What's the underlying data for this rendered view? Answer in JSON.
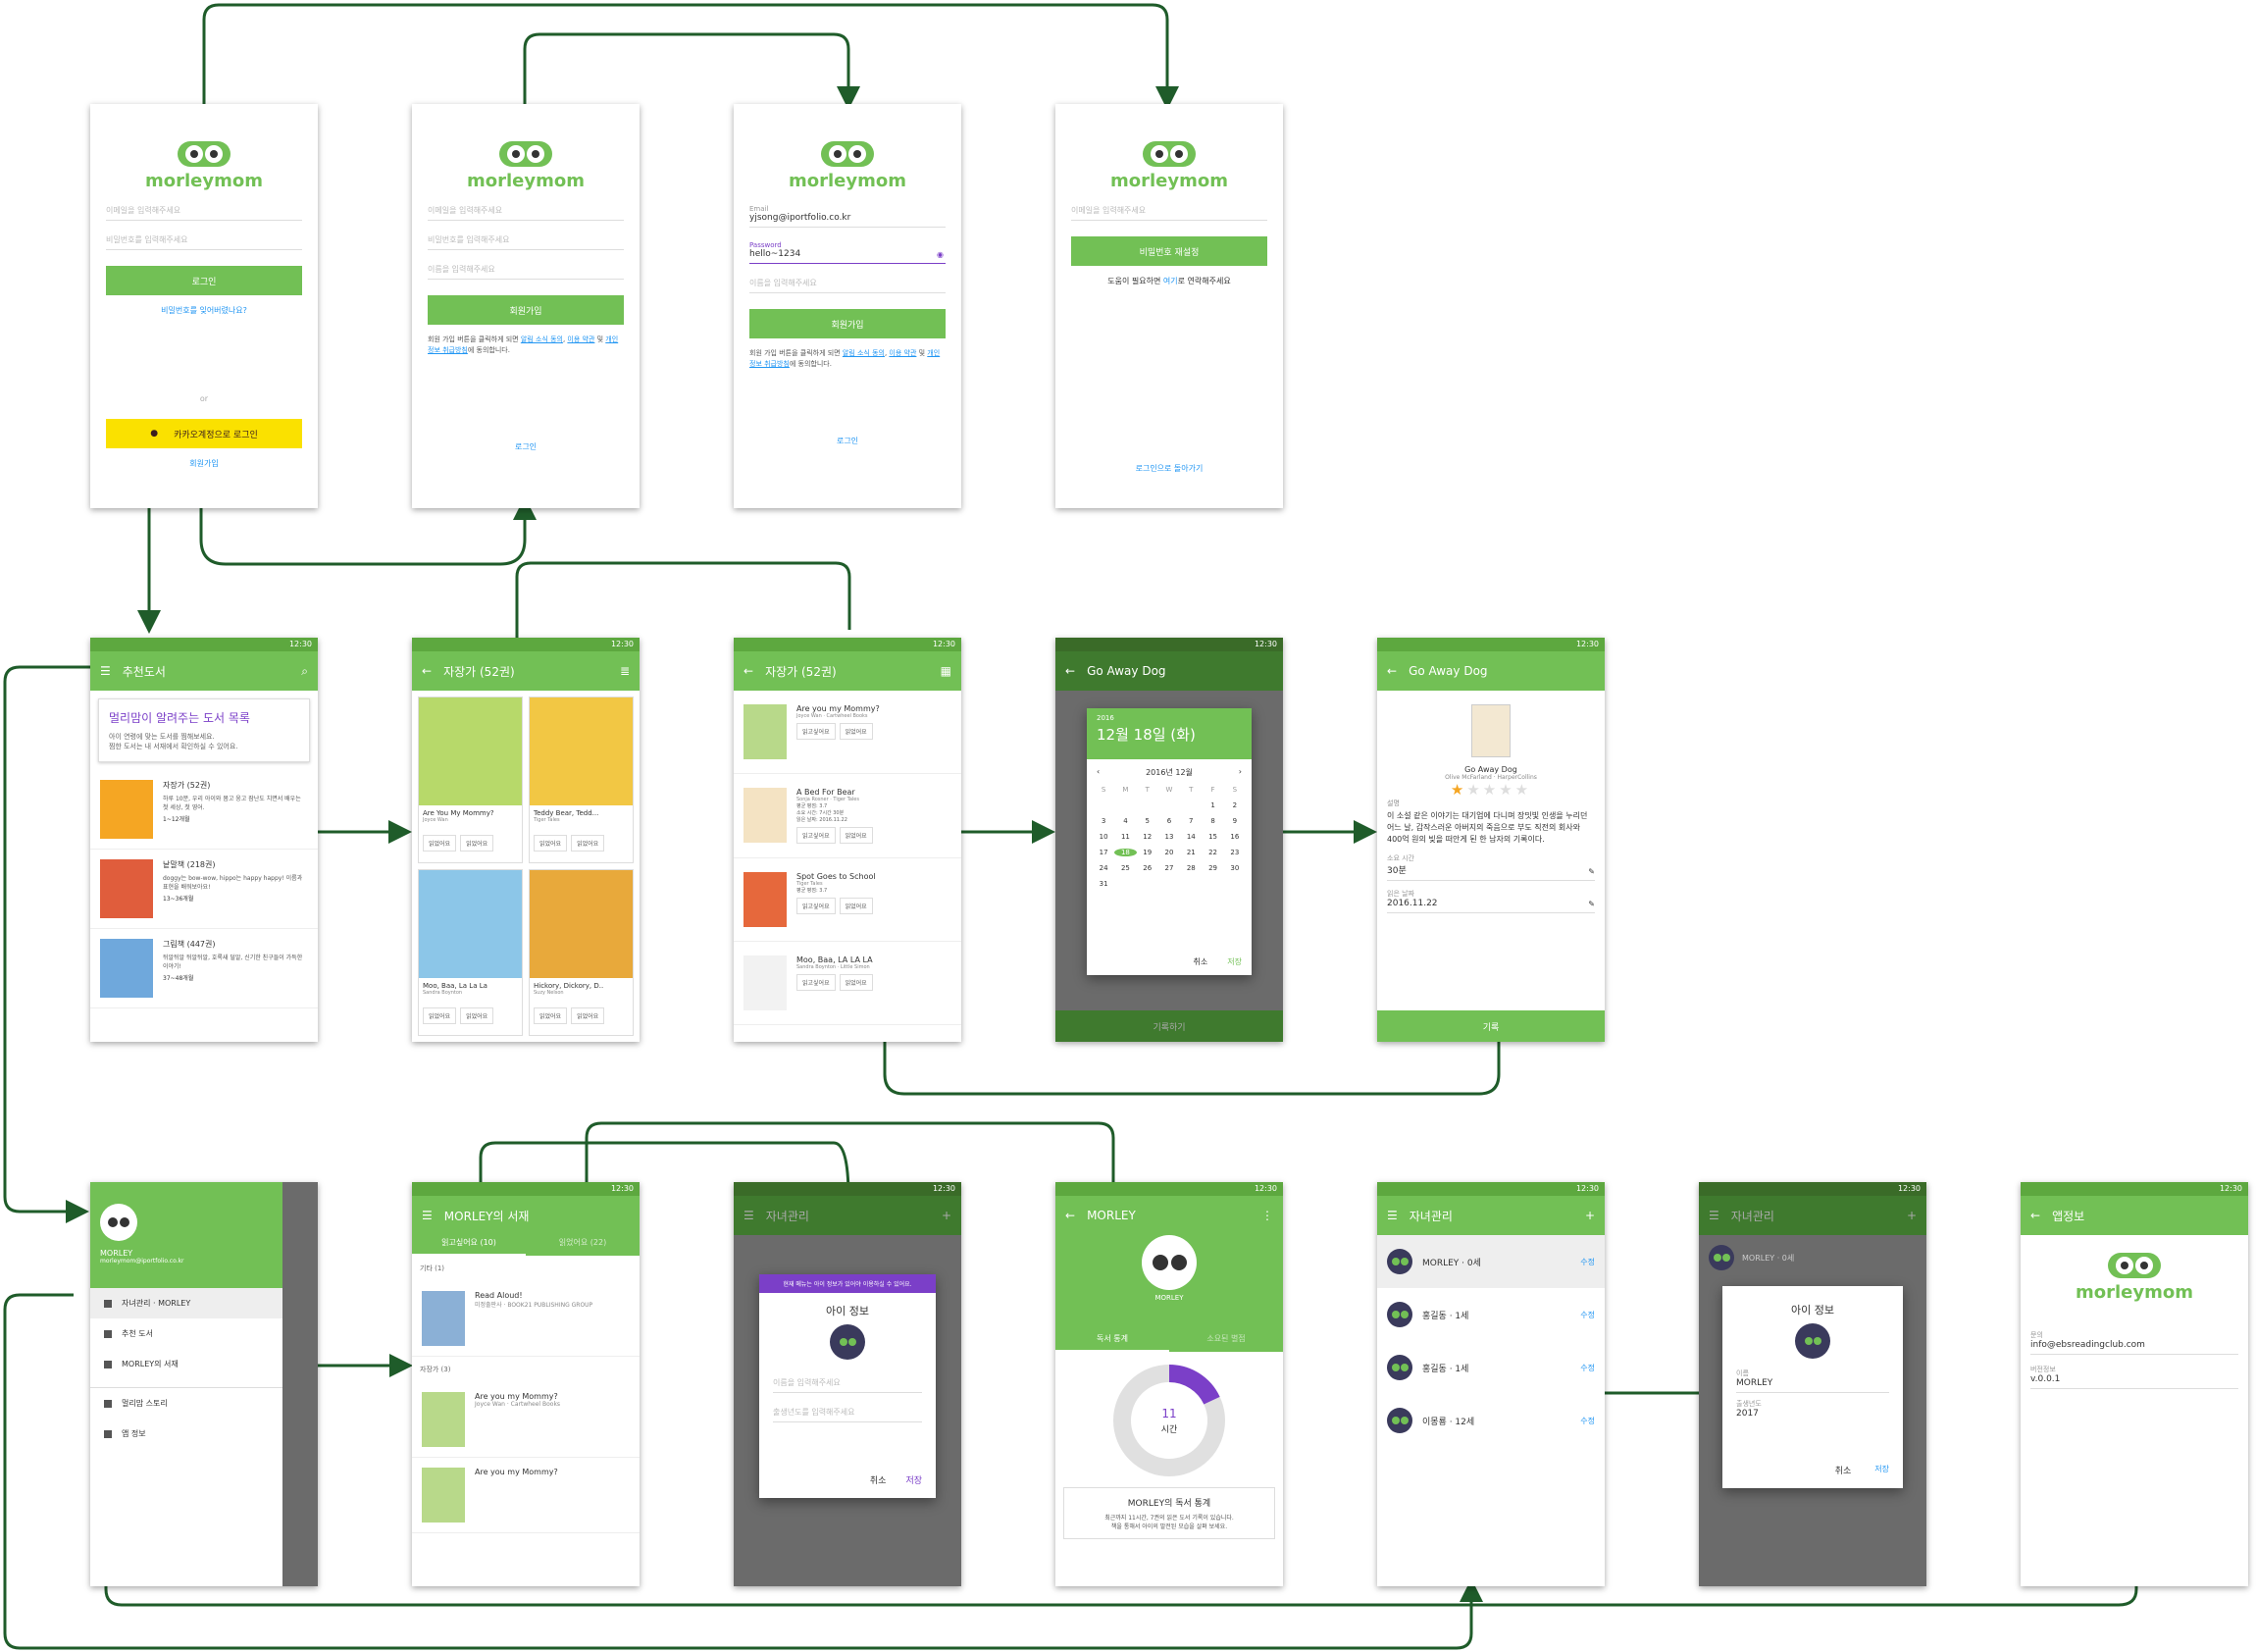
{
  "brand": "morleymom",
  "time": "12:30",
  "login": {
    "email_ph": "이메일을 입력해주세요",
    "pw_ph": "비밀번호를 입력해주세요",
    "login_btn": "로그인",
    "forgot": "비밀번호를 잊어버렸나요?",
    "or": "or",
    "kakao": "카카오계정으로 로그인",
    "signup_link": "회원가입"
  },
  "signup": {
    "email_ph": "이메일을 입력해주세요",
    "pw_ph": "비밀번호를 입력해주세요",
    "name_ph": "이름을 입력해주세요",
    "btn": "회원가입",
    "terms_pre": "회원 가입 버튼을 클릭하게 되면 ",
    "terms_a": "알림 소식 동의",
    "terms_b": "이용 약관",
    "terms_c": "개인정보 취급방침",
    "terms_post": "에 동의합니다.",
    "login_link": "로그인"
  },
  "signup_filled": {
    "email_label": "Email",
    "email": "yjsong@iportfolio.co.kr",
    "pw_label": "Password",
    "pw": "hello~1234"
  },
  "reset": {
    "btn": "비밀번호 재설정",
    "help_pre": "도움이 필요하면 ",
    "help_link": "여기",
    "help_post": "로 연락해주세요",
    "back": "로그인으로 돌아가기"
  },
  "home": {
    "title": "추천도서",
    "banner_title": "멀리맘이 알려주는 도서 목록",
    "banner_sub1": "아이 연령에 맞는 도서를 찜해보세요.",
    "banner_sub2": "찜한 도서는 내 서재에서 확인하실 수 있어요.",
    "cats": [
      {
        "name": "자장가 (52권)",
        "desc": "하루 10분, 우리 아이와 몸고 웅고 잠난도 치면서 배우는 첫 세상, 첫 영어.",
        "age": "1~12개월"
      },
      {
        "name": "낱말책 (218권)",
        "desc": "doggy는 bow-wow, hippo는 happy happy! 이름과 표현을 배워보아요!",
        "age": "13~36개월"
      },
      {
        "name": "그림책 (447권)",
        "desc": "뒤알뒤알 뒤알뒤알, 호록새 덜알, 신기한 친구들이 가득한 이야기!",
        "age": "37~48개월"
      }
    ]
  },
  "shelf": {
    "title": "자장가 (52권)",
    "books": [
      {
        "t": "Are You My Mommy?",
        "a": "Joyce Wan"
      },
      {
        "t": "Teddy Bear, Tedd...",
        "a": "Tiger Tales"
      },
      {
        "t": "Moo, Baa, La La La",
        "a": "Sandra Boynton"
      },
      {
        "t": "Hickory, Dickory, D..",
        "a": "Suzy Nelson"
      }
    ],
    "btn_a": "읽었어요",
    "btn_b": "읽었어요"
  },
  "shelf_list": {
    "title": "자장가 (52권)",
    "books": [
      {
        "t": "Are you my Mommy?",
        "a": "Joyce Wan · Cartwheel Books"
      },
      {
        "t": "A Bed For Bear",
        "a": "Sonja Rosner · Tiger Tales",
        "r": "평균 평점: 3.7",
        "time": "소요 시간: 7시간 30분",
        "date": "읽은 날짜: 2016.11.22"
      },
      {
        "t": "Spot Goes to School",
        "a": "Tiger Tales",
        "r": "평균 평점: 3.7"
      },
      {
        "t": "Moo, Baa, LA LA LA",
        "a": "Sandra Boynton · Little Simon"
      }
    ],
    "b1": "읽고싶어요",
    "b2": "읽었어요"
  },
  "cal": {
    "year": "2016",
    "date": "12월 18일 (화)",
    "month": "2016년 12월",
    "days": [
      "S",
      "M",
      "T",
      "W",
      "T",
      "F",
      "S"
    ],
    "cancel": "취소",
    "ok": "저장",
    "footer": "기록하기"
  },
  "detail": {
    "title": "Go Away Dog",
    "book": "Go Away Dog",
    "author": "Olive McFarland · HarperCollins",
    "desc_label": "설명",
    "desc": "이 소설 같은 이야기는 대기업에 다니며 장밋빛 인생을 누리던 어느 날, 갑작스러운 아버지의 죽음으로 부도 직전의 회사와 400억 원의 빚을 떠안게 된 한 남자의 기록이다.",
    "time_label": "소요 시간",
    "time": "30분",
    "date_label": "읽은 날짜",
    "date": "2016.11.22",
    "btn": "기록"
  },
  "drawer": {
    "name": "MORLEY",
    "email": "morleymom@iportfolio.co.kr",
    "items": [
      "자녀관리 · MORLEY",
      "추천 도서",
      "MORLEY의 서재",
      "멀리맘 스토리",
      "앱 정보"
    ]
  },
  "library": {
    "title": "MORLEY의 서재",
    "tab1": "읽고싶어요 (10)",
    "tab2": "읽었어요 (22)",
    "sec1": "기타 (1)",
    "b1": "Read Aloud!",
    "b1a": "미정출판사 · BOOK21 PUBLISHING GROUP",
    "sec2": "자장가 (3)",
    "b2": "Are you my Mommy?",
    "b2a": "Joyce Wan · Cartwheel Books",
    "b3": "Are you my Mommy?"
  },
  "child_dlg": {
    "title": "자녀관리",
    "notice": "현재 메뉴는 아이 정보가 있어야 이용하실 수 있어요.",
    "dlg_title": "아이 정보",
    "name_ph": "이름을 입력해주세요",
    "birth_ph": "출생년도를 입력해주세요",
    "cancel": "취소",
    "ok": "저장"
  },
  "stats": {
    "title": "MORLEY",
    "name": "MORLEY",
    "tab1": "독서 통계",
    "tab2": "소요된 별점",
    "hours": "11",
    "unit": "시간",
    "card_title": "MORLEY의 독서 통계",
    "card_line1": "최근까지 11시간, 7권의 읽은 도서 기록이 있습니다.",
    "card_line2": "책을 통해서 아이의 발전된 모습을 살펴 보세요.",
    "fraction": 0.18
  },
  "children": {
    "title": "자녀관리",
    "edit": "수정",
    "list": [
      {
        "n": "MORLEY · 0세"
      },
      {
        "n": "홍길동 · 1세"
      },
      {
        "n": "홍길동 · 1세"
      },
      {
        "n": "이몽룡 · 12세"
      }
    ]
  },
  "child_edit": {
    "title": "자녀관리",
    "dlg_title": "아이 정보",
    "name_label": "이름",
    "name": "MORLEY",
    "birth_label": "출생년도",
    "birth": "2017",
    "cancel": "취소",
    "ok": "저장"
  },
  "appinfo": {
    "title": "앱정보",
    "contact_label": "문의",
    "contact": "info@ebsreadingclub.com",
    "ver_label": "버전정보",
    "ver": "v.0.0.1"
  },
  "colors": {
    "green": "#72c055",
    "dark_arrow": "#1f5c2a",
    "purple": "#7b3fc8"
  }
}
